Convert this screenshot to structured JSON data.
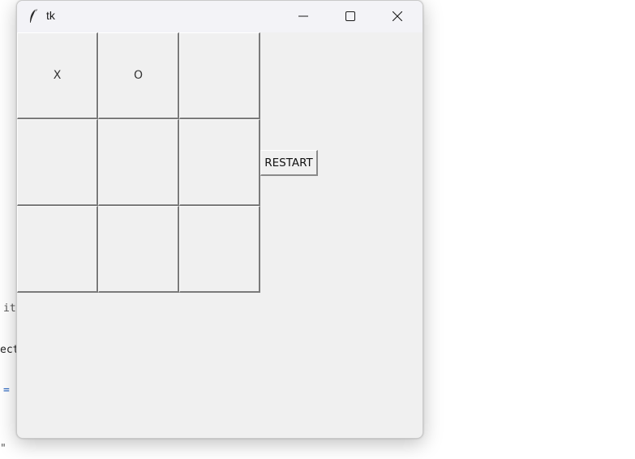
{
  "window": {
    "title": "tk",
    "icon": "tk-feather-icon"
  },
  "titlebar_controls": {
    "minimize": "minimize-icon",
    "maximize": "maximize-icon",
    "close": "close-icon"
  },
  "board": {
    "cells": [
      "X",
      "O",
      "",
      "",
      "",
      "",
      "",
      "",
      ""
    ]
  },
  "restart_label": "RESTART",
  "background_code": {
    "line1": "it",
    "line2": "ect",
    "line3": "=",
    "line4": "\""
  }
}
